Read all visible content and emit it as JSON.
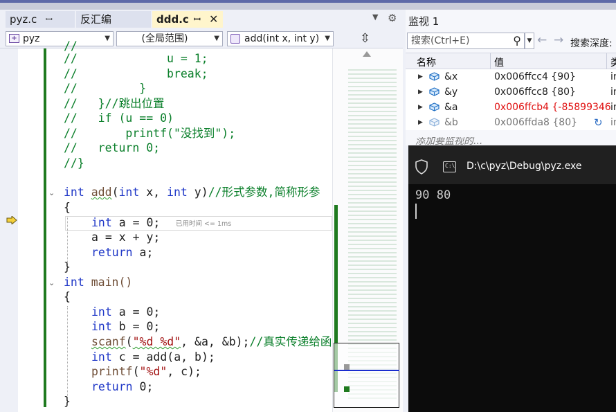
{
  "tabs": [
    {
      "label": "pyz.c",
      "pin": "ꟷ"
    },
    {
      "label": "反汇编"
    },
    {
      "label": "ddd.c",
      "pin": "ꟷ",
      "close": "✕"
    }
  ],
  "nav": {
    "project": "pyz",
    "scope": "(全局范围)",
    "function": "add(int x, int y)"
  },
  "code": {
    "l1_indent": "//             u = 1;",
    "l2": "//             break;",
    "l3": "//         }",
    "l4a": "//   }",
    "l4b": "//跳出位置",
    "l5a": "//   if (u == 0)",
    "l6a": "//       printf(\"没找到\");",
    "l7a": "//   return 0;",
    "l8a": "//}",
    "add_kw": "int",
    "add_fn": "add",
    "add_params_a": "(",
    "add_int1": "int",
    "add_x": " x, ",
    "add_int2": "int",
    "add_y": " y)",
    "add_comment": "//形式参数,简称形参",
    "brace_open": "{",
    "brace_close": "}",
    "a_decl_kw": "int",
    "a_decl_rest": " a = 0;",
    "elapsed": "已用时间 <= 1ms",
    "a_assign": "a = x + y;",
    "return_kw": "return",
    "return_a": " a;",
    "main_kw": "int",
    "main_fn": " main()",
    "ma_kw": "int",
    "ma_rest": " a = 0;",
    "mb_kw": "int",
    "mb_rest": " b = 0;",
    "scanf_fn": "scanf",
    "scanf_open": "(",
    "scanf_fmt": "\"%d %d\"",
    "scanf_rest": ", &a, &b);",
    "scanf_comment": "//真实传递给函",
    "mc_kw": "int",
    "mc_rest": " c = add(a, b);",
    "printf_fn": "printf",
    "printf_open": "(",
    "printf_fmt": "\"%d\"",
    "printf_rest": ", c);",
    "ret0_kw": "return",
    "ret0_rest": " 0;"
  },
  "watch": {
    "title": "监视 1",
    "search_placeholder": "搜索(Ctrl+E)",
    "depth_label": "搜索深度:",
    "col_name": "名称",
    "col_value": "值",
    "col_type": "类",
    "rows": [
      {
        "name": "&x",
        "value": "0x006ffcc4 {90}",
        "type": "in"
      },
      {
        "name": "&y",
        "value": "0x006ffcc8 {80}",
        "type": "in"
      },
      {
        "name": "&a",
        "value": "0x006ffcb4 {-85899346...",
        "type": "in"
      },
      {
        "name": "&b",
        "value": "0x006ffda8 {80}",
        "type": "in"
      }
    ],
    "add_hint": "添加要监视的..."
  },
  "console": {
    "path": "D:\\c\\pyz\\Debug\\pyz.exe",
    "output": "90 80",
    "icon_text": "C:\\"
  }
}
